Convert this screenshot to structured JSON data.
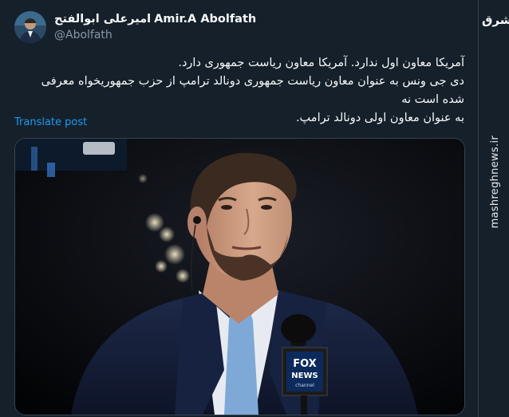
{
  "author": {
    "name_fa": "امیرعلی ابوالفتح",
    "name_en": "Amir.A Abolfath",
    "handle": "@Abolfath"
  },
  "post": {
    "line1": "آمریکا معاون اول ندارد. آمریکا معاون ریاست جمهوری دارد.",
    "line2": "دی جی ونس به عنوان معاون ریاست جمهوری دونالد ترامپ از حزب جمهوریخواه معرفی شده است نه",
    "line3": "به عنوان معاون اولی دونالد ترامپ.",
    "translate_label": "Translate post"
  },
  "media": {
    "mic_label_top": "FOX",
    "mic_label_bottom": "NEWS",
    "mic_label_channel": "channel"
  },
  "watermark": {
    "logo": "مشرق",
    "site": "mashreghnews.ir"
  },
  "colors": {
    "background": "#15202b",
    "link": "#1d9bf0",
    "secondary_text": "#8b98a5"
  }
}
